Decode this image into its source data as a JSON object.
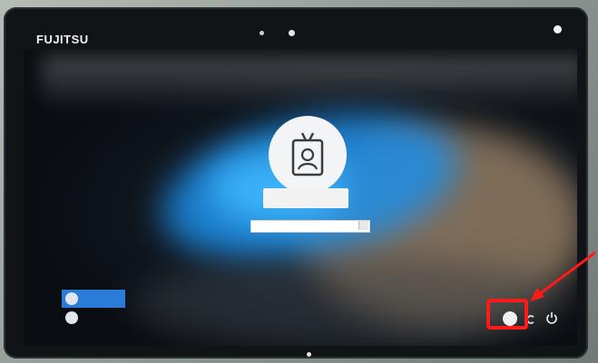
{
  "device": {
    "brand": "FUJITSU"
  },
  "lock_screen": {
    "user_name": "",
    "password": {
      "value": "",
      "placeholder": ""
    }
  },
  "users": [
    {
      "label": ""
    },
    {
      "label": ""
    }
  ],
  "icons": {
    "avatar": "id-badge-icon",
    "network": "network-icon",
    "ease_of_access": "ease-of-access-icon",
    "power": "power-icon",
    "arrow": "arrow-annotation"
  },
  "colors": {
    "highlight": "#ff1a1a",
    "selected_user": "#2b7bd8"
  }
}
